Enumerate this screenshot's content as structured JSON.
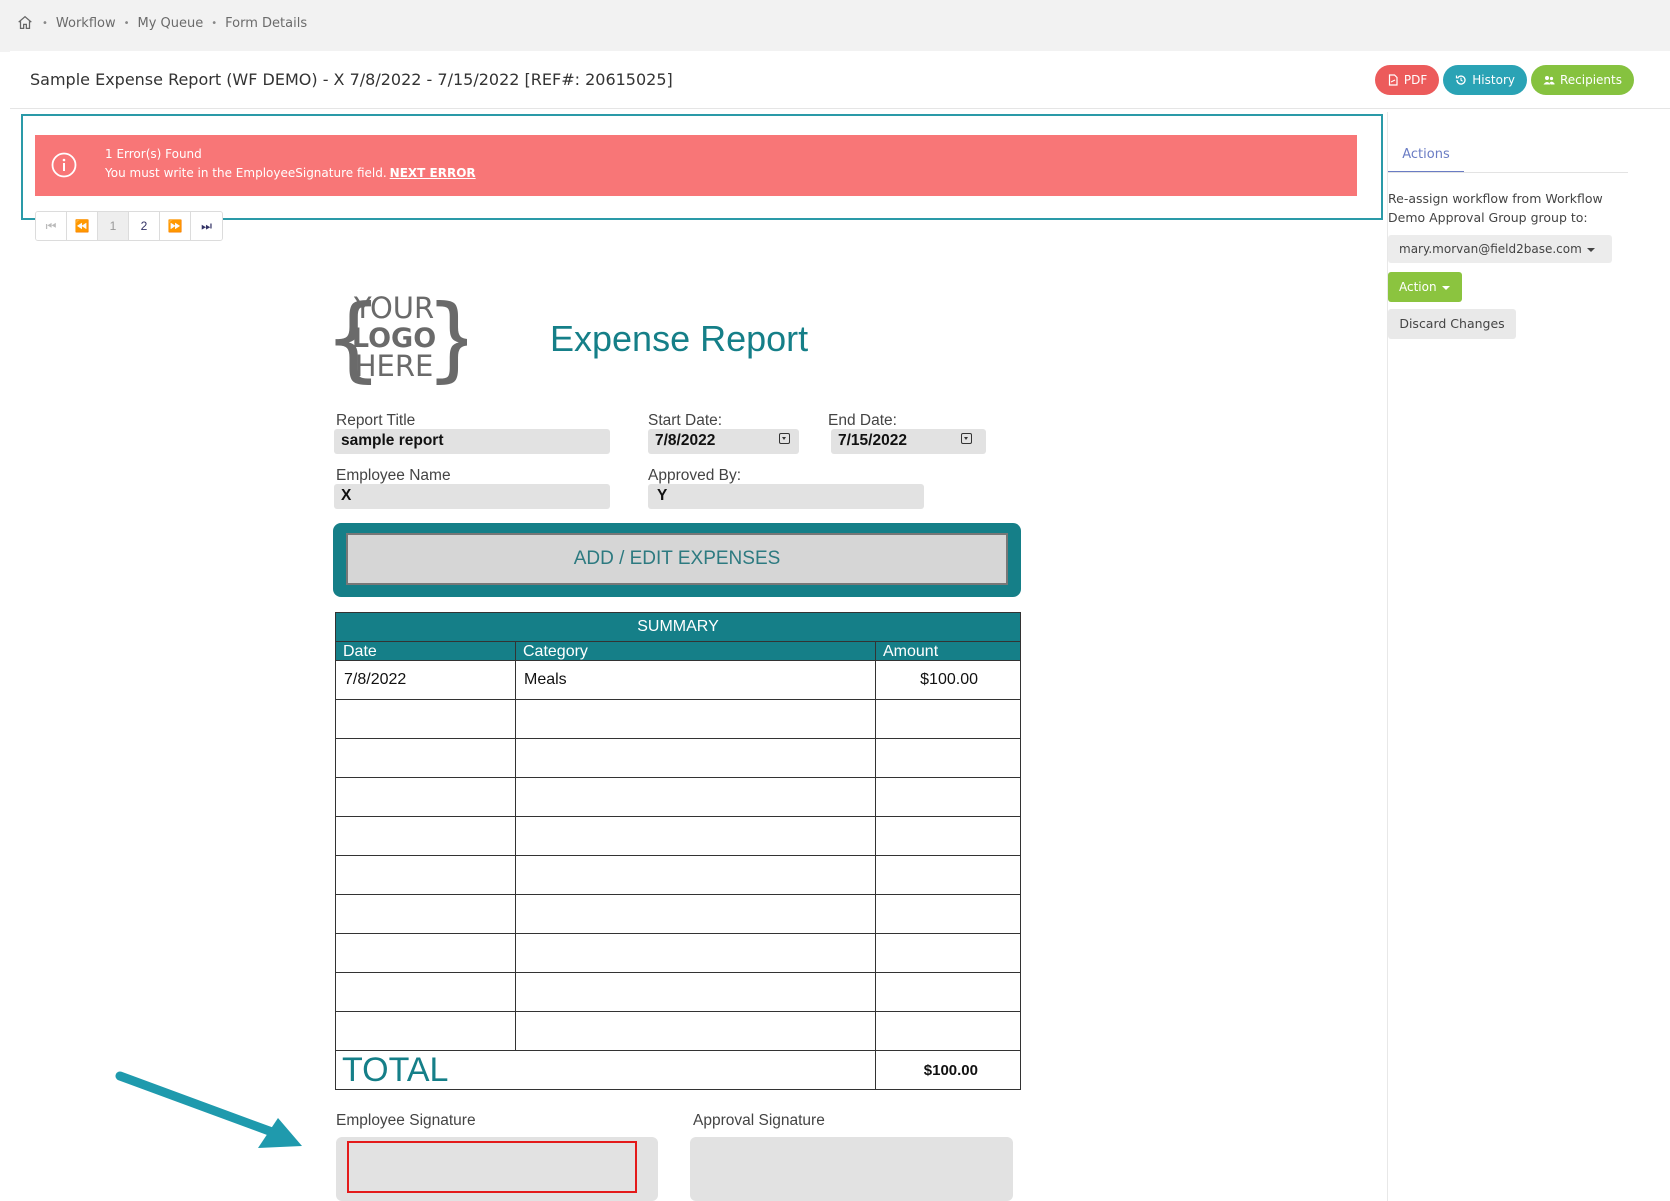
{
  "breadcrumb": {
    "items": [
      "Workflow",
      "My Queue",
      "Form Details"
    ]
  },
  "header": {
    "title": "Sample Expense Report (WF DEMO) - X 7/8/2022 - 7/15/2022 [REF#: 20615025]",
    "buttons": {
      "pdf": "PDF",
      "history": "History",
      "recipients": "Recipients"
    }
  },
  "error": {
    "title": "1 Error(s) Found",
    "message": "You must write in the EmployeeSignature field.",
    "link": "NEXT ERROR"
  },
  "pager": {
    "pages": [
      "1",
      "2"
    ],
    "current": "1"
  },
  "sidebar": {
    "tab": "Actions",
    "reassign_text": "Re-assign workflow from Workflow Demo Approval Group group to:",
    "assignee": "mary.morvan@field2base.com",
    "action_label": "Action",
    "discard_label": "Discard Changes"
  },
  "form": {
    "logo": {
      "line1": "YOUR",
      "line2": "LOGO",
      "line3": "HERE"
    },
    "title": "Expense Report",
    "report_title": {
      "label": "Report Title",
      "value": "sample report"
    },
    "start_date": {
      "label": "Start Date:",
      "value": "7/8/2022"
    },
    "end_date": {
      "label": "End Date:",
      "value": "7/15/2022"
    },
    "employee_name": {
      "label": "Employee Name",
      "value": "X"
    },
    "approved_by": {
      "label": "Approved By:",
      "value": "Y"
    },
    "expenses_button": "ADD / EDIT EXPENSES",
    "summary": {
      "caption": "SUMMARY",
      "columns": [
        "Date",
        "Category",
        "Amount"
      ],
      "rows": [
        [
          "7/8/2022",
          "Meals",
          "$100.00"
        ],
        [
          "",
          "",
          ""
        ],
        [
          "",
          "",
          ""
        ],
        [
          "",
          "",
          ""
        ],
        [
          "",
          "",
          ""
        ],
        [
          "",
          "",
          ""
        ],
        [
          "",
          "",
          ""
        ],
        [
          "",
          "",
          ""
        ],
        [
          "",
          "",
          ""
        ],
        [
          "",
          "",
          ""
        ]
      ],
      "total_label": "TOTAL",
      "total_value": "$100.00"
    },
    "employee_signature_label": "Employee Signature",
    "approval_signature_label": "Approval Signature"
  },
  "colors": {
    "teal": "#157f88",
    "error": "#f87677",
    "pdf": "#ec5b5b",
    "history": "#2aa3b5",
    "recipients": "#86c23f"
  }
}
